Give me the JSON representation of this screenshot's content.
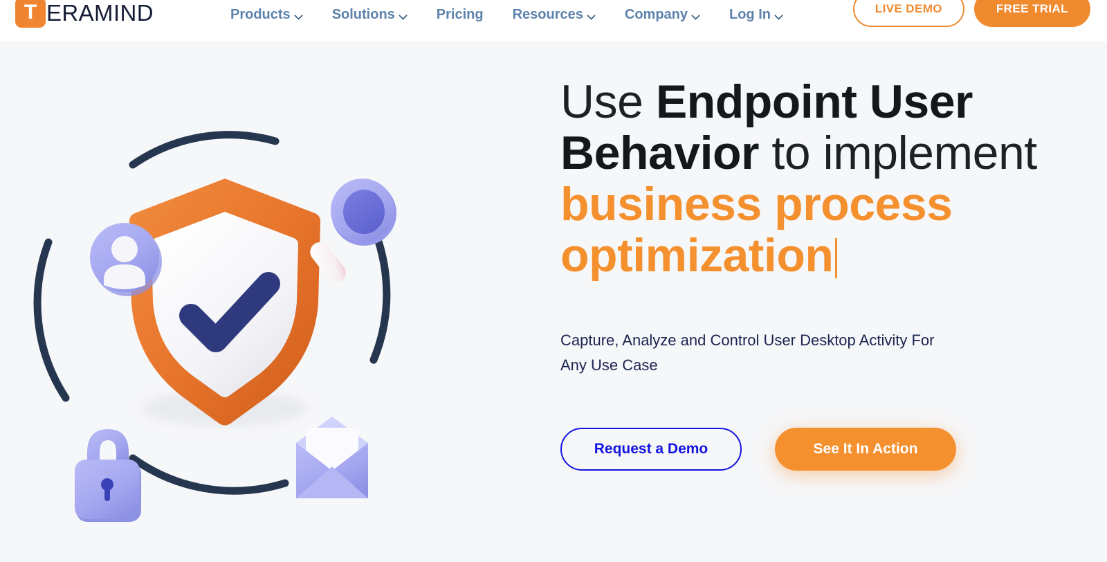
{
  "brand": {
    "logo_mark": "T",
    "logo_word": "ERAMIND",
    "logo_color": "#ef8530"
  },
  "header": {
    "nav_items": [
      {
        "label": "Products",
        "has_dropdown": true,
        "icon": "chevron-down-icon"
      },
      {
        "label": "Solutions",
        "has_dropdown": true,
        "icon": "chevron-down-icon"
      },
      {
        "label": "Pricing",
        "has_dropdown": false,
        "icon": ""
      },
      {
        "label": "Resources",
        "has_dropdown": true,
        "icon": "chevron-down-icon"
      },
      {
        "label": "Company",
        "has_dropdown": true,
        "icon": "chevron-down-icon"
      },
      {
        "label": "Log In",
        "has_dropdown": true,
        "icon": "chevron-down-icon"
      }
    ],
    "live_demo_label": "LIVE DEMO",
    "free_trial_label": "FREE TRIAL",
    "nav_color": "#5c82ab",
    "accent_color": "#f08a2e"
  },
  "hero": {
    "headline": {
      "part1": "Use ",
      "part2_bold": "Endpoint User Behavior",
      "part3": " to implement ",
      "part4_accent": "business process optimization",
      "cursor_visible": true
    },
    "subtitle": "Capture, Analyze and Control User Desktop Activity For Any Use Case",
    "primary_cta": "Request a Demo",
    "secondary_cta": "See It In Action",
    "primary_cta_color": "#1414e0",
    "secondary_cta_color": "#f5902f",
    "illustration": {
      "name": "security-shield-3d-illustration",
      "elements": [
        "shield-check-icon",
        "user-avatar-icon",
        "magnifying-glass-icon",
        "padlock-icon",
        "envelope-icon",
        "orbit-arc-decoration"
      ],
      "shield_color": "#e8762c",
      "check_color": "#2f3a7e",
      "periwinkle_color": "#a5a8f0",
      "arc_color": "#26364f"
    }
  },
  "page_background": "#f6f7f9"
}
